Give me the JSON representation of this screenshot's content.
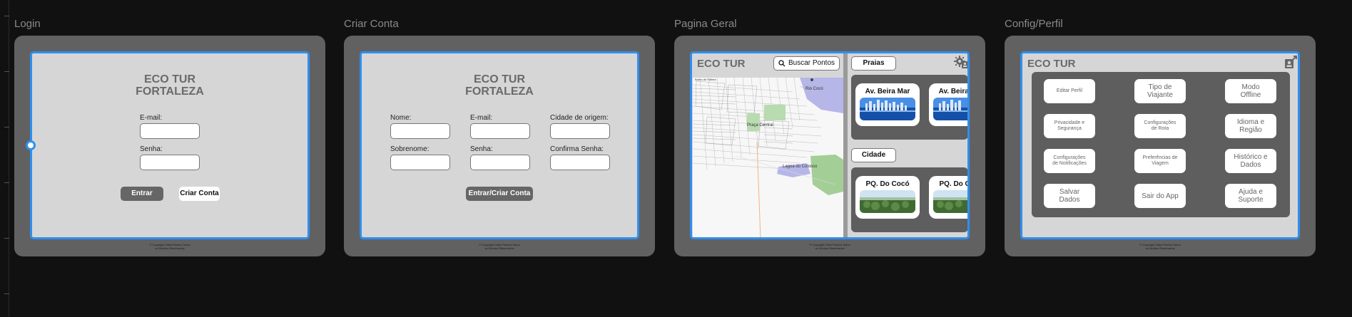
{
  "frames": [
    {
      "label": "Login"
    },
    {
      "label": "Criar Conta"
    },
    {
      "label": "Pagina Geral"
    },
    {
      "label": "Config/Perfil"
    }
  ],
  "copyright": [
    "© Copyright Tales Pereira Todos",
    "os Direitos Reservados"
  ],
  "login": {
    "title_line1": "ECO TUR",
    "title_line2": "FORTALEZA",
    "email_label": "E-mail:",
    "password_label": "Senha:",
    "enter_button": "Entrar",
    "create_button": "Criar Conta"
  },
  "signup": {
    "title_line1": "ECO TUR",
    "title_line2": "FORTALEZA",
    "name_label": "Nome:",
    "email_label": "E-mail:",
    "city_label": "Cidade de origem:",
    "surname_label": "Sobrenome:",
    "password_label": "Senha:",
    "confirm_label": "Confirma Senha:",
    "submit_button": "Entrar/Criar Conta"
  },
  "general": {
    "app_title": "ECO TUR",
    "search_button": "Buscar Pontos",
    "map_labels": {
      "tl": "Bairro de Fátima",
      "river": "Rio Cocó",
      "square": "Praça Central",
      "lake": "Lagoa do Colosso"
    },
    "beaches_tab": "Praias",
    "city_tab": "Cidade",
    "beach_cards": [
      "Av. Beira Mar",
      "Av. Beira Mar"
    ],
    "city_cards": [
      "PQ. Do Cocó",
      "PQ. Do Cocó"
    ]
  },
  "config": {
    "app_title": "ECO TUR",
    "buttons": [
      [
        "Editar Perfil"
      ],
      [
        "Tipo de",
        "Viajante"
      ],
      [
        "Modo",
        "Offline"
      ],
      [
        "Privacidade e",
        "Segurança"
      ],
      [
        "Configurações",
        "de Rota"
      ],
      [
        "Idioma e",
        "Região"
      ],
      [
        "Configurações",
        "de Notificações"
      ],
      [
        "Preferências de",
        "Viagem"
      ],
      [
        "Histórico e",
        "Dados"
      ],
      [
        "Salvar",
        "Dados"
      ],
      [
        "Sair do App"
      ],
      [
        "Ajuda e",
        "Suporte"
      ]
    ]
  }
}
